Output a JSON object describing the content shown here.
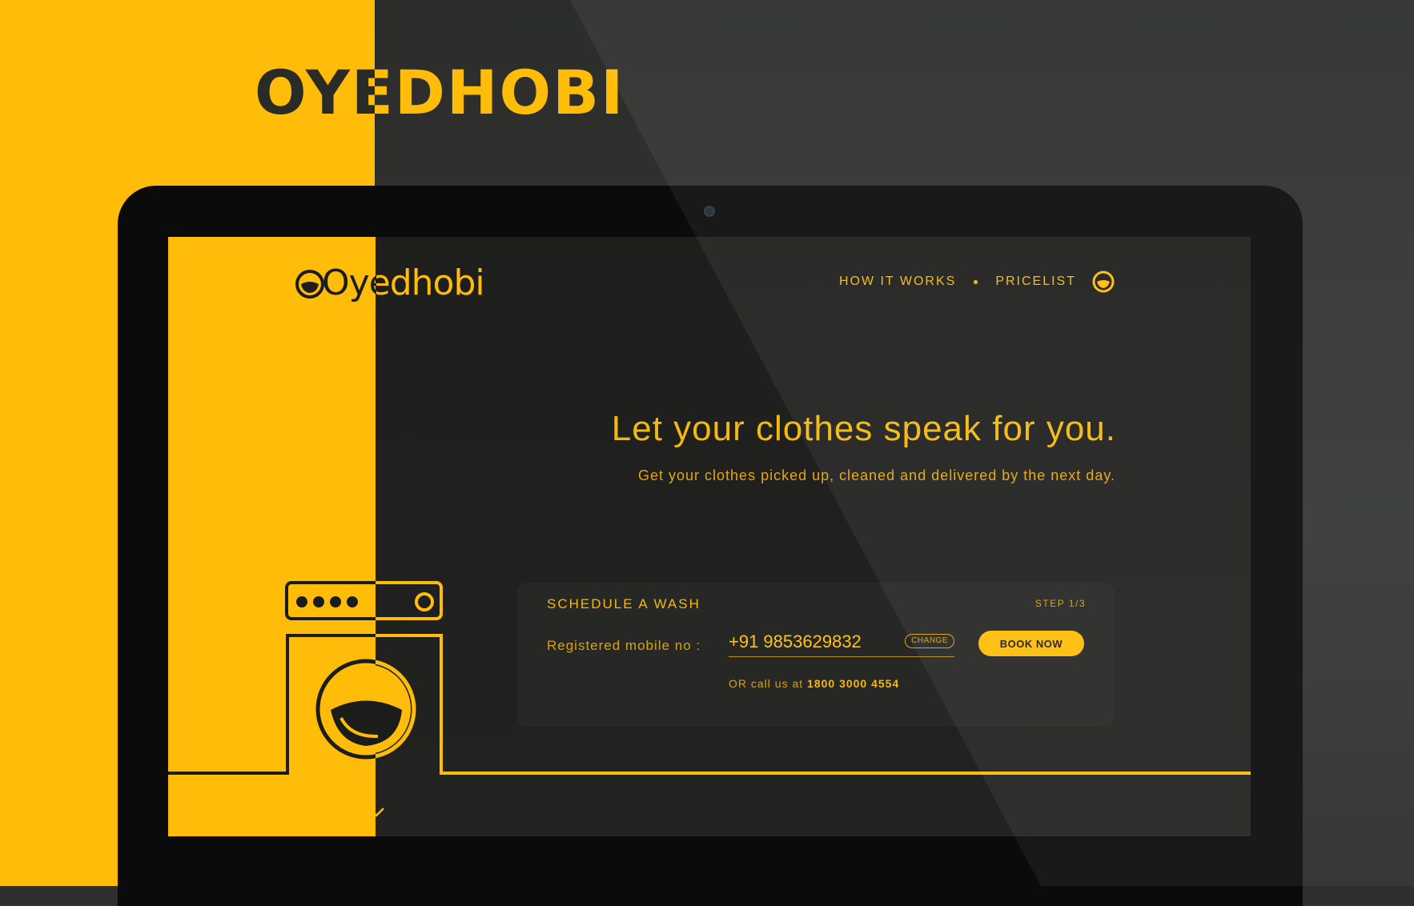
{
  "page_title": "OYEDHOBI",
  "colors": {
    "brand_yellow": "#ffbd0a",
    "dark": "#1d1d1c"
  },
  "site": {
    "logo_text": "Oyedhobi",
    "nav": {
      "how_it_works": "HOW IT WORKS",
      "pricelist": "PRICELIST",
      "account_icon": "user-face-icon"
    },
    "hero": {
      "title": "Let your clothes speak for you.",
      "subtitle": "Get your clothes picked up, cleaned and delivered by the next day."
    },
    "schedule": {
      "title": "SCHEDULE A WASH",
      "step": "STEP 1/3",
      "mobile_label": "Registered mobile no :",
      "mobile_value": "+91 9853629832",
      "change_label": "CHANGE",
      "book_label": "BOOK NOW",
      "call_prefix": "OR call us at",
      "call_number": "1800 3000 4554"
    },
    "scroll_icon": "chevron-down-icon",
    "illustration_icon": "washing-machine-icon"
  }
}
